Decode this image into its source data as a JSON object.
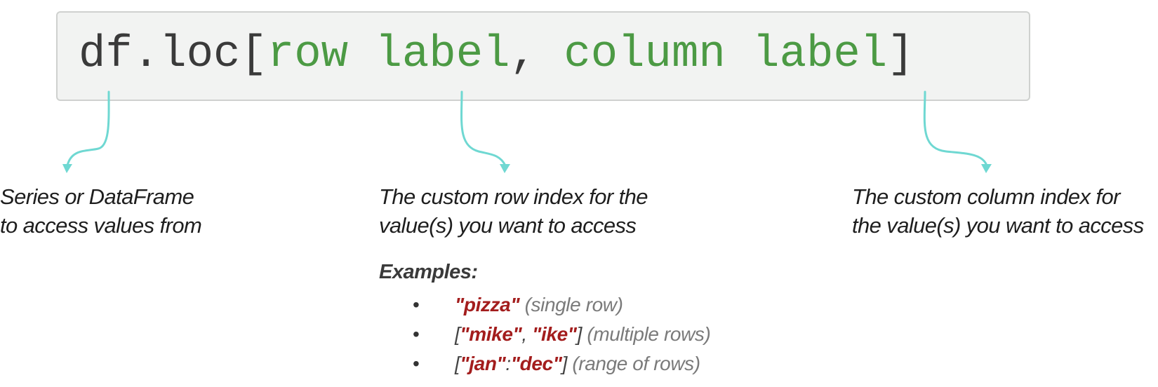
{
  "code": {
    "prefix": "df.loc[",
    "arg1": "row label",
    "separator": ", ",
    "arg2": "column label",
    "suffix": "]"
  },
  "colors": {
    "arrow": "#6fd8d2",
    "code_arg": "#4c9a44",
    "example_key": "#a31d1d"
  },
  "annotations": [
    {
      "line1": "Series or DataFrame",
      "line2": "to access values from"
    },
    {
      "line1": "The custom row index for the",
      "line2": "value(s) you want to access"
    },
    {
      "line1": "The custom column index for",
      "line2": "the value(s) you want to access"
    }
  ],
  "examples": {
    "heading": "Examples:",
    "items": [
      {
        "open": "",
        "key1": "\"pizza\"",
        "mid": "",
        "key2": "",
        "close": "",
        "note": " (single row)"
      },
      {
        "open": "[",
        "key1": "\"mike\"",
        "mid": ", ",
        "key2": "\"ike\"",
        "close": "]",
        "note": " (multiple rows)"
      },
      {
        "open": "[",
        "key1": "\"jan\"",
        "mid": ":",
        "key2": "\"dec\"",
        "close": "]",
        "note": " (range of rows)"
      }
    ]
  }
}
